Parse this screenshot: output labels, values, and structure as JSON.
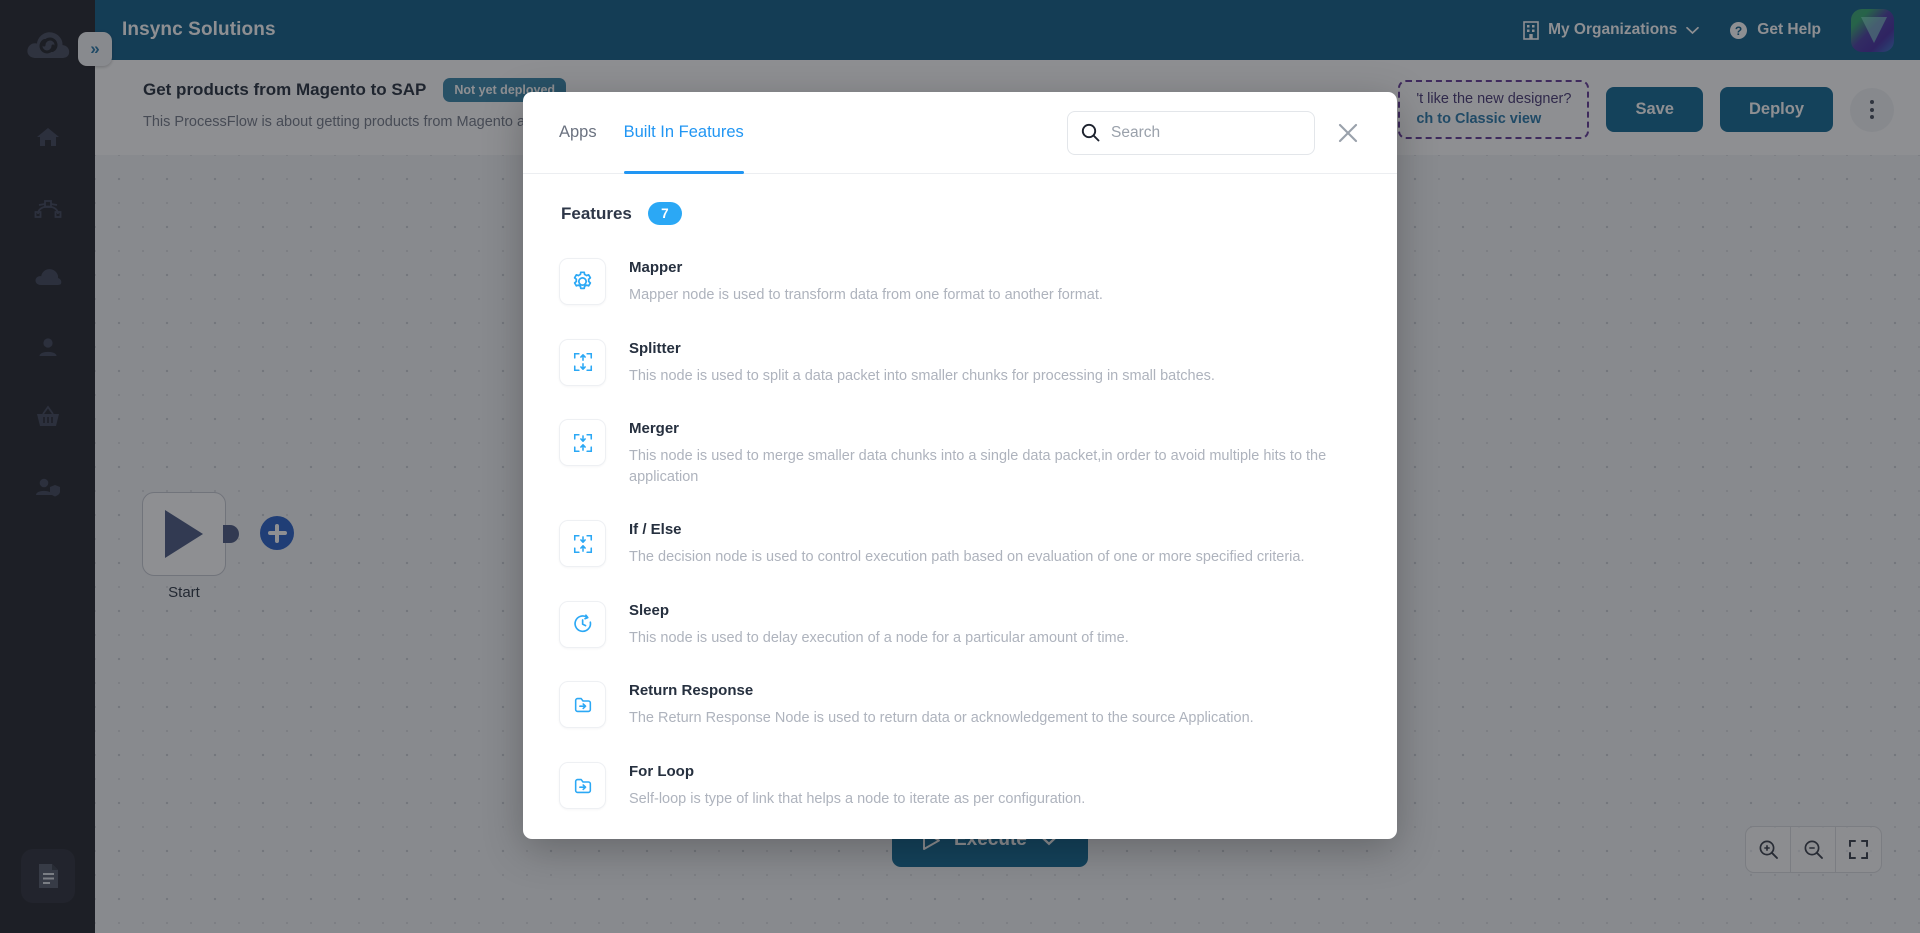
{
  "topbar": {
    "app_title": "Insync Solutions",
    "logo_icon": "cloud-sync-icon",
    "expand_icon": "chevrons-right-icon",
    "organizations_label": "My Organizations",
    "organizations_icon": "building-icon",
    "organizations_chevron": "chevron-down-icon",
    "help_label": "Get Help",
    "help_icon": "question-circle-icon",
    "avatar": "user-avatar"
  },
  "sidebar": {
    "items": [
      {
        "name": "home",
        "icon": "home-icon"
      },
      {
        "name": "flows",
        "icon": "node-graph-icon"
      },
      {
        "name": "cloud",
        "icon": "cloud-icon"
      },
      {
        "name": "users",
        "icon": "user-icon"
      },
      {
        "name": "marketplace",
        "icon": "basket-icon"
      },
      {
        "name": "roles",
        "icon": "user-shield-icon"
      }
    ],
    "bottom_item": {
      "name": "logs",
      "icon": "document-icon"
    }
  },
  "page_header": {
    "title": "Get products from Magento to SAP",
    "status_badge": "Not yet deployed",
    "subtitle": "This ProcessFlow is about getting products from Magento and upd",
    "classic_banner_line1": "'t like the new designer?",
    "classic_banner_line2": "ch to Classic view",
    "save_label": "Save",
    "deploy_label": "Deploy",
    "more_icon": "kebab-menu-icon"
  },
  "canvas": {
    "start_node_label": "Start",
    "start_node_icon": "play-icon",
    "add_node_icon": "plus-icon",
    "execute_label": "Execute",
    "execute_icon": "play-outline-icon",
    "execute_chevron": "chevron-down-icon",
    "zoom_in_icon": "zoom-in-icon",
    "zoom_out_icon": "zoom-out-icon",
    "fit_screen_icon": "fit-screen-icon"
  },
  "modal": {
    "tabs": [
      {
        "label": "Apps",
        "active": false
      },
      {
        "label": "Built In Features",
        "active": true
      }
    ],
    "search": {
      "placeholder": "Search",
      "value": "",
      "icon": "search-icon"
    },
    "close_icon": "close-icon",
    "section_title": "Features",
    "section_count": "7",
    "features": [
      {
        "name": "Mapper",
        "description": "Mapper node is used to transform data from one format to another format.",
        "icon": "gear-icon"
      },
      {
        "name": "Splitter",
        "description": "This node is used to split a data packet into smaller chunks for processing in small batches.",
        "icon": "split-arrows-icon"
      },
      {
        "name": "Merger",
        "description": "This node is used to merge smaller data chunks into a single data packet,in order to avoid multiple hits to the application",
        "icon": "merge-arrows-icon"
      },
      {
        "name": "If / Else",
        "description": "The decision node is used to control execution path based on evaluation of one or more specified criteria.",
        "icon": "merge-arrows-icon"
      },
      {
        "name": "Sleep",
        "description": "This node is used to delay execution of a node for a particular amount of time.",
        "icon": "clock-arrow-icon"
      },
      {
        "name": "Return Response",
        "description": "The Return Response Node is used to return data or acknowledgement to the source Application.",
        "icon": "return-arrow-icon"
      },
      {
        "name": "For Loop",
        "description": "Self-loop is type of link that helps a node to iterate as per configuration.",
        "icon": "return-arrow-icon"
      }
    ]
  },
  "colors": {
    "topbar_blue": "#005480",
    "accent_blue": "#2196f3",
    "icon_blue": "#2BA8F5",
    "button_blue": "#005e8c",
    "badge_blue": "#2b7ea4",
    "rail_dark": "#14161f",
    "purple_dashed": "#5b2d91"
  }
}
